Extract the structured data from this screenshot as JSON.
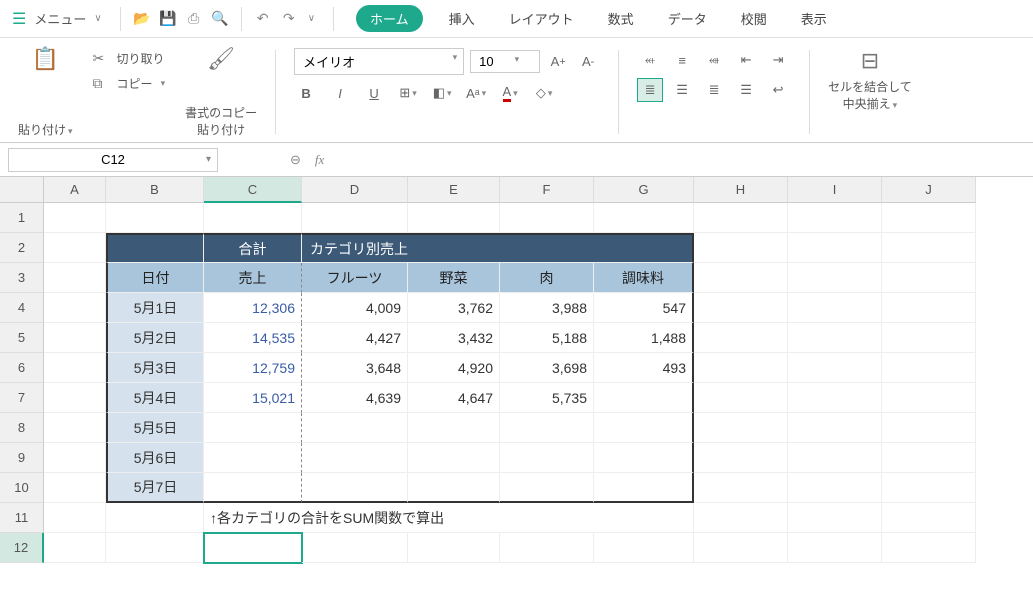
{
  "menu": {
    "label": "メニュー"
  },
  "tabs": {
    "home": "ホーム",
    "insert": "挿入",
    "layout": "レイアウト",
    "formulas": "数式",
    "data": "データ",
    "review": "校閲",
    "view": "表示"
  },
  "ribbon": {
    "paste": "貼り付け",
    "cut": "切り取り",
    "copy": "コピー",
    "format_painter": "書式のコピー\n貼り付け",
    "font_name": "メイリオ",
    "font_size": "10",
    "merge": "セルを結合して\n中央揃え"
  },
  "namebox": "C12",
  "fx": "fx",
  "cols": [
    "A",
    "B",
    "C",
    "D",
    "E",
    "F",
    "G",
    "H",
    "I",
    "J"
  ],
  "rows": [
    "1",
    "2",
    "3",
    "4",
    "5",
    "6",
    "7",
    "8",
    "9",
    "10",
    "11",
    "12"
  ],
  "table": {
    "title_total": "合計",
    "title_cat": "カテゴリ別売上",
    "headers": {
      "date": "日付",
      "sales": "売上",
      "fruit": "フルーツ",
      "veg": "野菜",
      "meat": "肉",
      "spice": "調味料"
    },
    "rows": [
      {
        "date": "5月1日",
        "sales": "12,306",
        "fruit": "4,009",
        "veg": "3,762",
        "meat": "3,988",
        "spice": "547"
      },
      {
        "date": "5月2日",
        "sales": "14,535",
        "fruit": "4,427",
        "veg": "3,432",
        "meat": "5,188",
        "spice": "1,488"
      },
      {
        "date": "5月3日",
        "sales": "12,759",
        "fruit": "3,648",
        "veg": "4,920",
        "meat": "3,698",
        "spice": "493"
      },
      {
        "date": "5月4日",
        "sales": "15,021",
        "fruit": "4,639",
        "veg": "4,647",
        "meat": "5,735",
        "spice": ""
      },
      {
        "date": "5月5日",
        "sales": "",
        "fruit": "",
        "veg": "",
        "meat": "",
        "spice": ""
      },
      {
        "date": "5月6日",
        "sales": "",
        "fruit": "",
        "veg": "",
        "meat": "",
        "spice": ""
      },
      {
        "date": "5月7日",
        "sales": "",
        "fruit": "",
        "veg": "",
        "meat": "",
        "spice": ""
      }
    ],
    "note": "↑各カテゴリの合計をSUM関数で算出"
  }
}
